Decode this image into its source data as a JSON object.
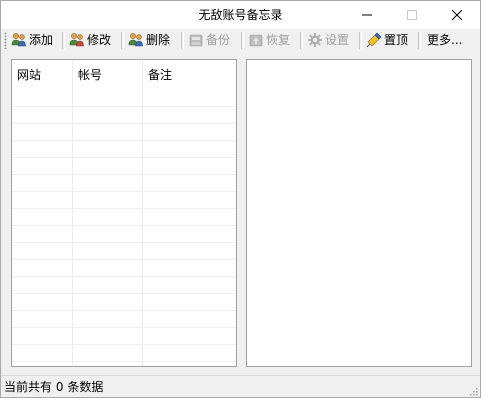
{
  "window": {
    "title": "无敌账号备忘录"
  },
  "toolbar": {
    "add_label": "添加",
    "edit_label": "修改",
    "delete_label": "删除",
    "backup_label": "备份",
    "restore_label": "恢复",
    "settings_label": "设置",
    "pin_label": "置顶",
    "more_label": "更多..."
  },
  "list": {
    "columns": [
      "网站",
      "帐号",
      "备注"
    ],
    "rows": []
  },
  "status": {
    "prefix": "当前共有",
    "count": "0",
    "suffix": "条数据"
  }
}
